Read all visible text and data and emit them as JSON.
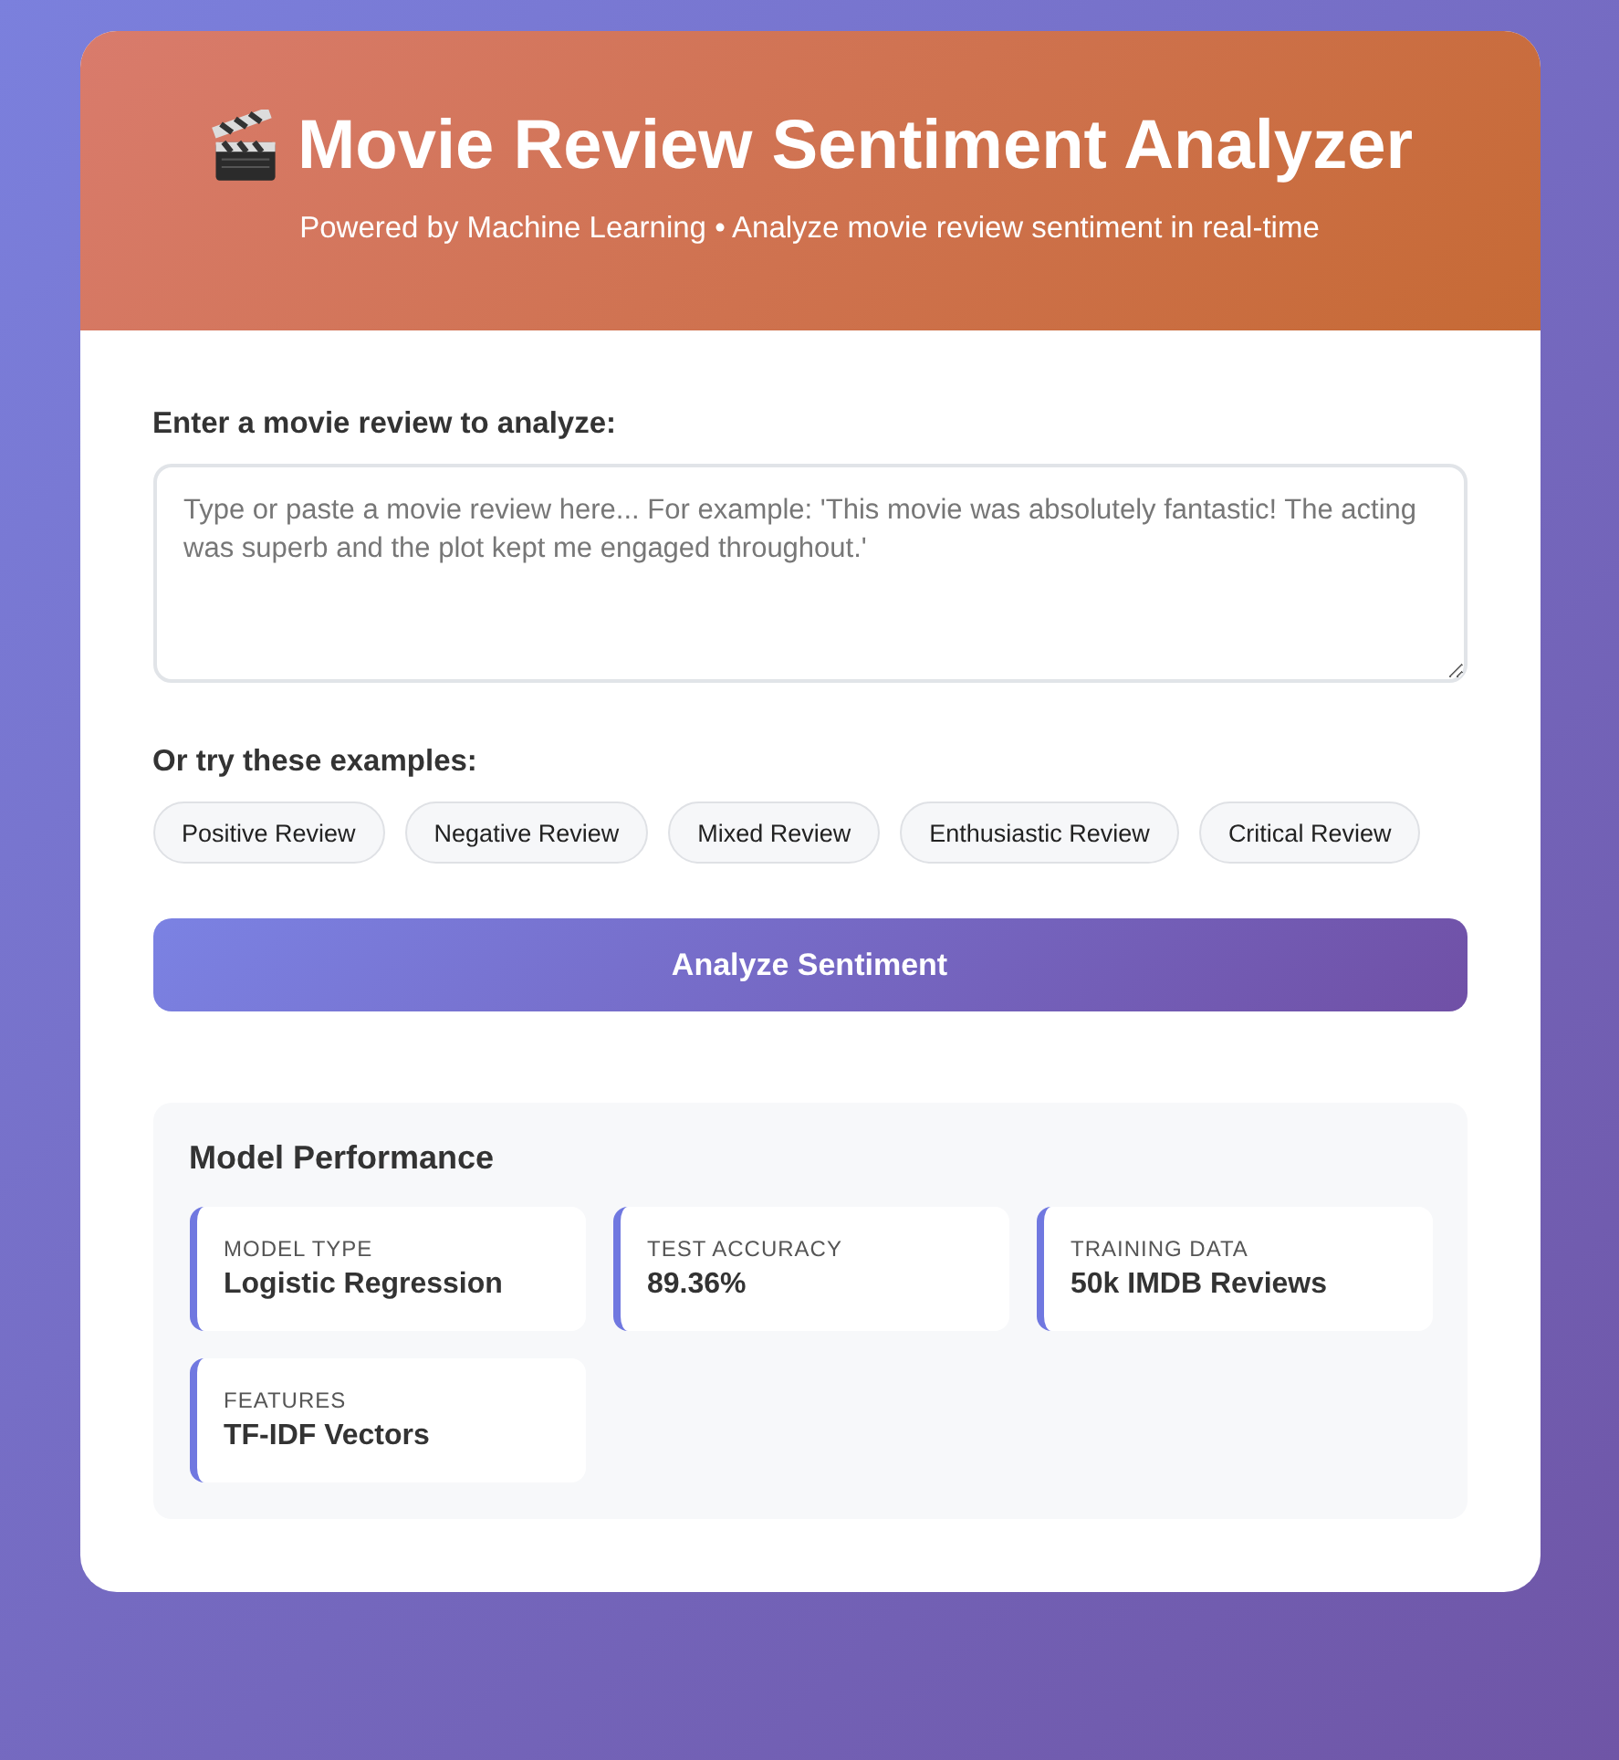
{
  "header": {
    "title": "Movie Review Sentiment Analyzer",
    "subtitle": "Powered by Machine Learning • Analyze movie review sentiment in real-time"
  },
  "review_input": {
    "label": "Enter a movie review to analyze:",
    "placeholder": "Type or paste a movie review here... For example: 'This movie was absolutely fantastic! The acting was superb and the plot kept me engaged throughout.'"
  },
  "examples": {
    "label": "Or try these examples:",
    "buttons": [
      "Positive Review",
      "Negative Review",
      "Mixed Review",
      "Enthusiastic Review",
      "Critical Review"
    ]
  },
  "analyze_button": "Analyze Sentiment",
  "model_performance": {
    "title": "Model Performance",
    "stats": [
      {
        "label": "MODEL TYPE",
        "value": "Logistic Regression"
      },
      {
        "label": "TEST ACCURACY",
        "value": "89.36%"
      },
      {
        "label": "TRAINING DATA",
        "value": "50k IMDB Reviews"
      },
      {
        "label": "FEATURES",
        "value": "TF-IDF Vectors"
      }
    ]
  }
}
